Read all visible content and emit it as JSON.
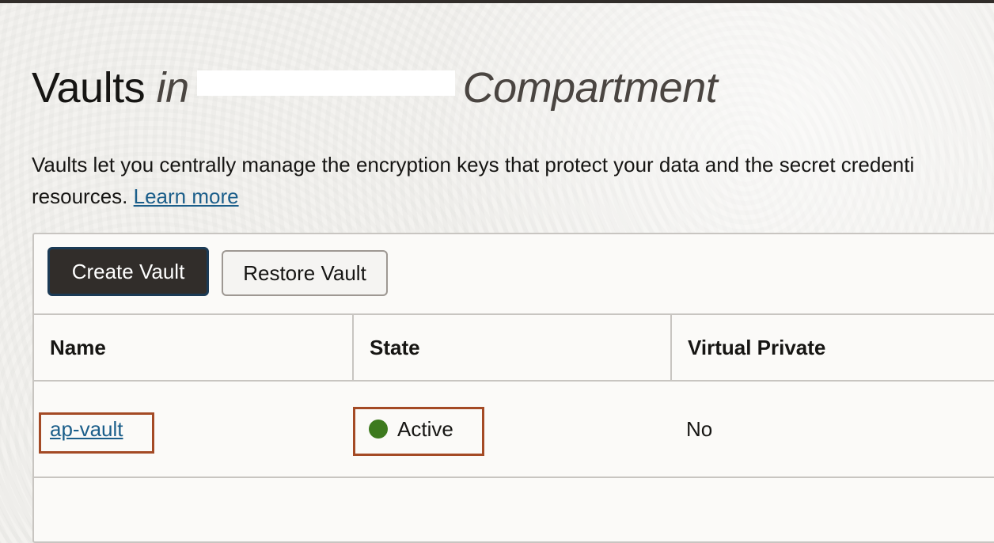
{
  "header": {
    "title_main": "Vaults",
    "title_in": "in",
    "title_suffix": "Compartment"
  },
  "description": {
    "text": "Vaults let you centrally manage the encryption keys that protect your data and the secret credenti",
    "text_line2": "resources.",
    "learn_more": "Learn more"
  },
  "toolbar": {
    "create_label": "Create Vault",
    "restore_label": "Restore Vault"
  },
  "table": {
    "columns": [
      "Name",
      "State",
      "Virtual Private"
    ],
    "rows": [
      {
        "name": "ap-vault",
        "state": "Active",
        "virtual_private": "No"
      }
    ]
  },
  "colors": {
    "state_active": "#3d7a1e",
    "highlight_border": "#a44a25",
    "link": "#1b5e8a",
    "primary_button": "#312d2a"
  },
  "icons": {
    "state_indicator": "status-dot-icon"
  }
}
